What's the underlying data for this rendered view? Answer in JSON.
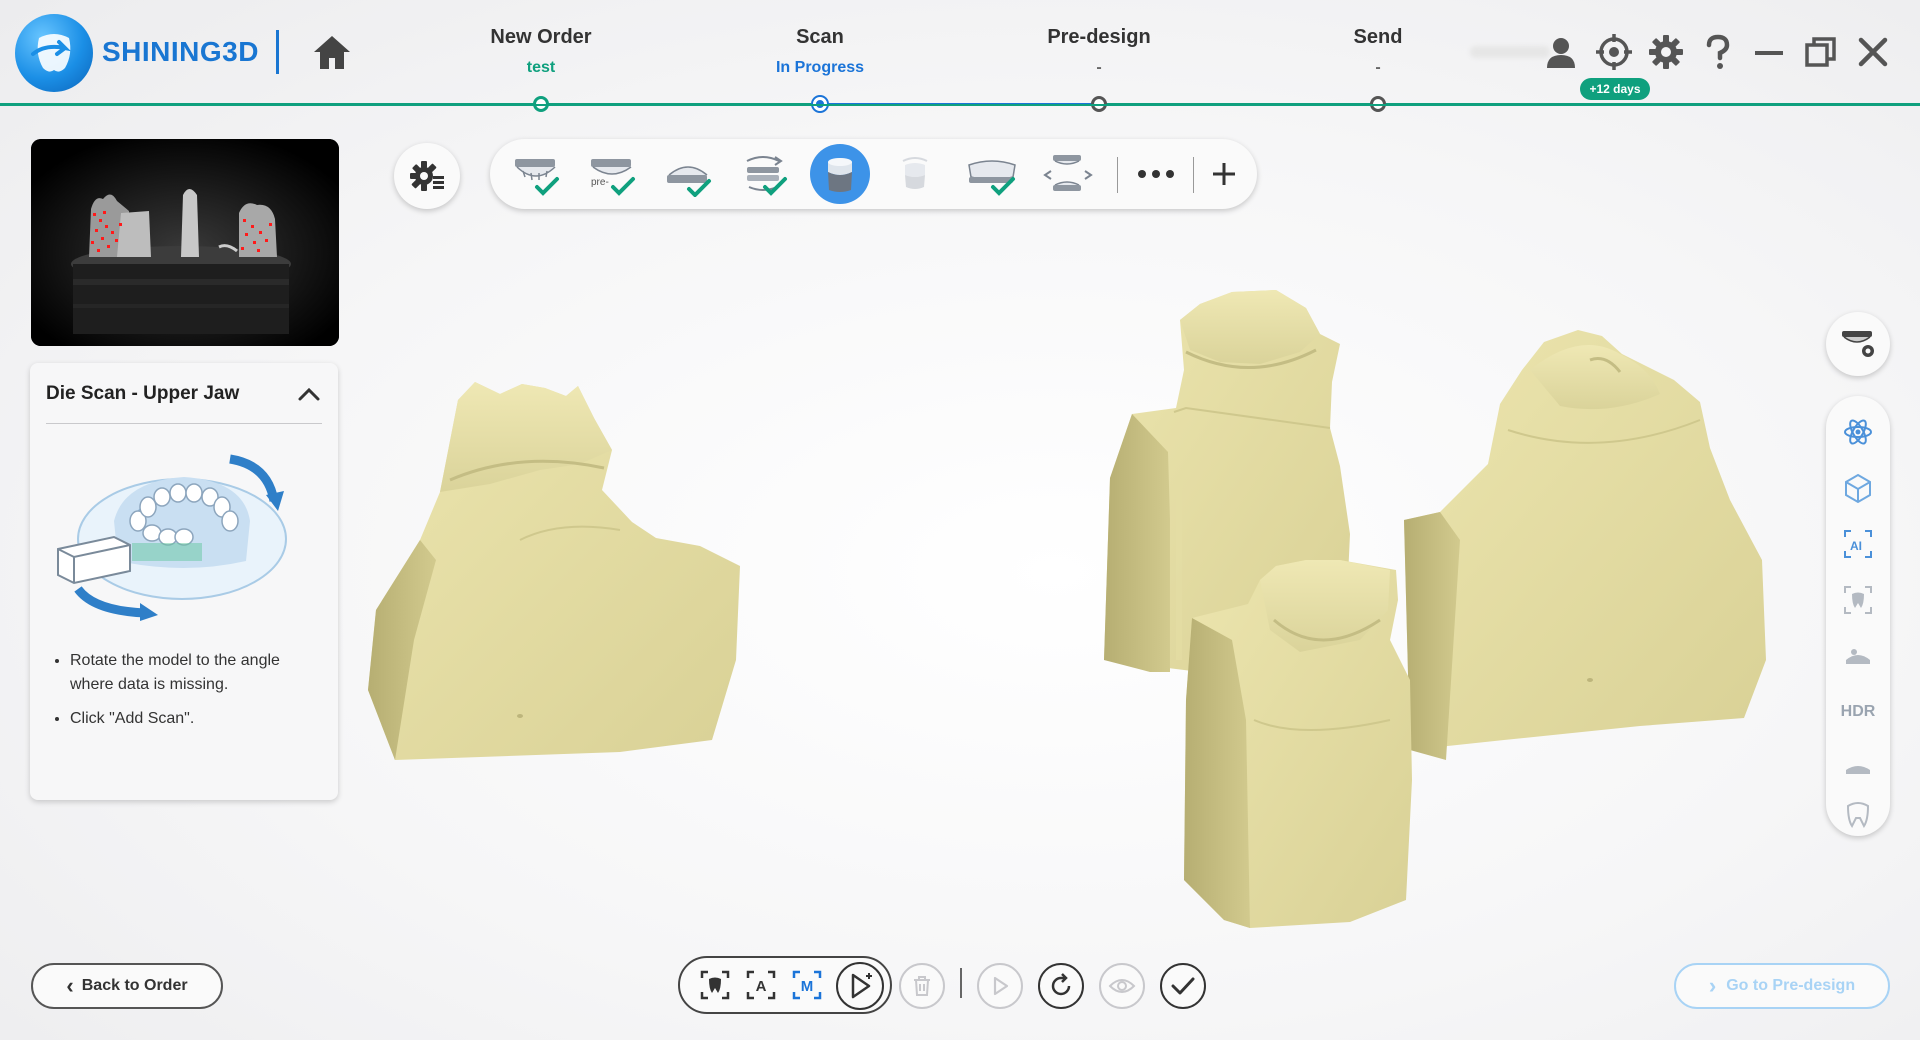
{
  "header": {
    "brand": "SHINING3D",
    "steps": [
      {
        "name": "New Order",
        "status": "test"
      },
      {
        "name": "Scan",
        "status": "In Progress"
      },
      {
        "name": "Pre-design",
        "status": "-"
      },
      {
        "name": "Send",
        "status": "-"
      }
    ],
    "trial_badge": "+12 days"
  },
  "left_panel": {
    "guide_title": "Die Scan - Upper Jaw",
    "instructions": [
      "Rotate the model to the angle where data is missing.",
      "Click \"Add Scan\"."
    ]
  },
  "toolbar": {
    "items": [
      {
        "icon": "upper-jaw-scan-icon",
        "done": true
      },
      {
        "icon": "pre-op-scan-icon",
        "label": "pre-",
        "done": true
      },
      {
        "icon": "lower-jaw-scan-icon",
        "done": true
      },
      {
        "icon": "bite-scan-icon",
        "done": true
      },
      {
        "icon": "die-scan-icon",
        "active": true
      },
      {
        "icon": "gingiva-scan-icon",
        "disabled": true
      },
      {
        "icon": "antagonist-scan-icon",
        "done": true
      },
      {
        "icon": "occlusion-scan-icon",
        "done": false
      }
    ]
  },
  "right_tools": {
    "hdr_label": "HDR"
  },
  "bottom": {
    "back_label": "Back to Order",
    "bracket_labels": [
      "A",
      "M"
    ],
    "next_label": "Go to Pre-design"
  },
  "colors": {
    "accent_green": "#0fa07e",
    "accent_blue": "#1b74d8",
    "die_color": "#e3dca0"
  }
}
